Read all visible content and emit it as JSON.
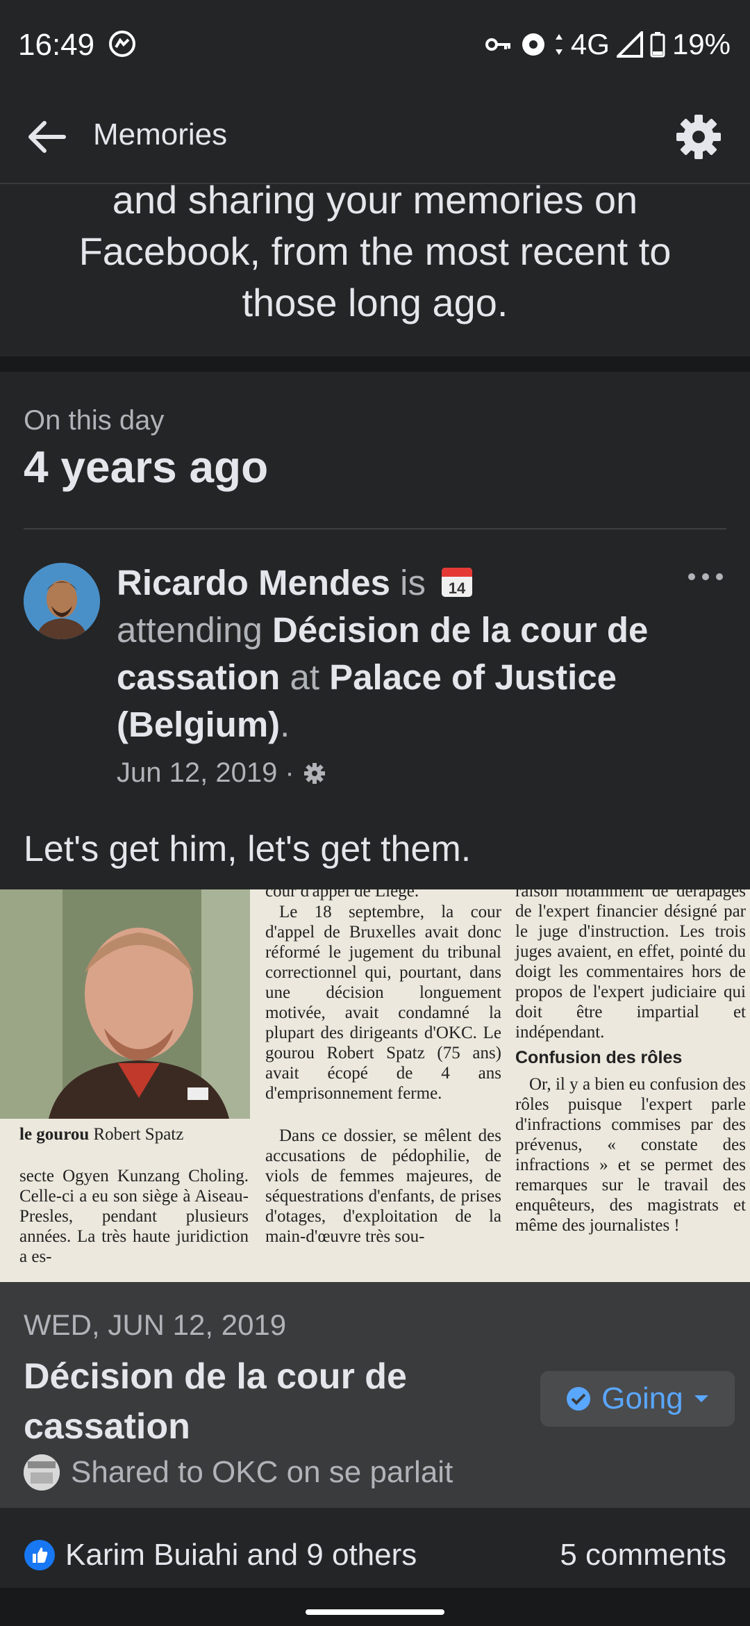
{
  "status_bar": {
    "time": "16:49",
    "network": "4G",
    "battery": "19%"
  },
  "app_bar": {
    "title": "Memories"
  },
  "intro": {
    "text": "and sharing your memories on Facebook, from the most recent to those long ago."
  },
  "memory": {
    "day_label": "On this day",
    "years_ago": "4 years ago",
    "post": {
      "author": "Ricardo Mendes",
      "verb": "is",
      "attending": "attending",
      "event": "Décision de la cour de cassation",
      "at": "at",
      "place": "Palace of Justice (Belgium)",
      "period": ".",
      "date": "Jun 12, 2019 ·",
      "text": "Let's get him, let's get them."
    },
    "photo": {
      "caption_bold": "le gourou",
      "caption": "Robert Spatz",
      "col1_bottom": "secte Ogyen Kunzang Choling. Celle-ci a eu son siège à Aiseau-Presles, pendant plusieurs années. La très haute juridiction a es-",
      "col2_top": "cour d'appel de Liège.",
      "col2": "Le 18 septembre, la cour d'appel de Bruxelles avait donc réformé le jugement du tribunal correctionnel qui, pourtant, dans une décision longuement motivée, avait condamné la plupart des dirigeants d'OKC. Le gourou Robert Spatz (75 ans) avait écopé de 4 ans d'emprisonnement ferme.",
      "col2b": "Dans ce dossier, se mêlent des accusations de pédophilie, de viols de femmes majeures, de séquestrations d'enfants, de prises d'otages, d'exploitation de la main-d'œuvre très sou-",
      "col3_top": "raison notamment de dérapages de l'expert financier désigné par le juge d'instruction. Les trois juges avaient, en effet, pointé du doigt les commentaires hors de propos de l'expert judiciaire qui doit être impartial et indépendant.",
      "col3_heading": "Confusion des rôles",
      "col3": "Or, il y a bien eu confusion des rôles puisque l'expert parle d'infractions commises par des prévenus, « constate des infractions » et se permet des remarques sur le travail des enquêteurs, des magistrats et même des journalistes !"
    },
    "event": {
      "date": "WED, JUN 12, 2019",
      "title": "Décision de la cour de cassation",
      "going_label": "Going",
      "shared": "Shared to OKC on se parlait"
    },
    "reactions": "Karim Buiahi and 9 others",
    "comments": "5 comments"
  },
  "colors": {
    "background": "#18191a",
    "surface": "#242526",
    "event_bar": "#3a3b3c",
    "accent": "#5aa7ff",
    "like_blue": "#1877f2"
  }
}
